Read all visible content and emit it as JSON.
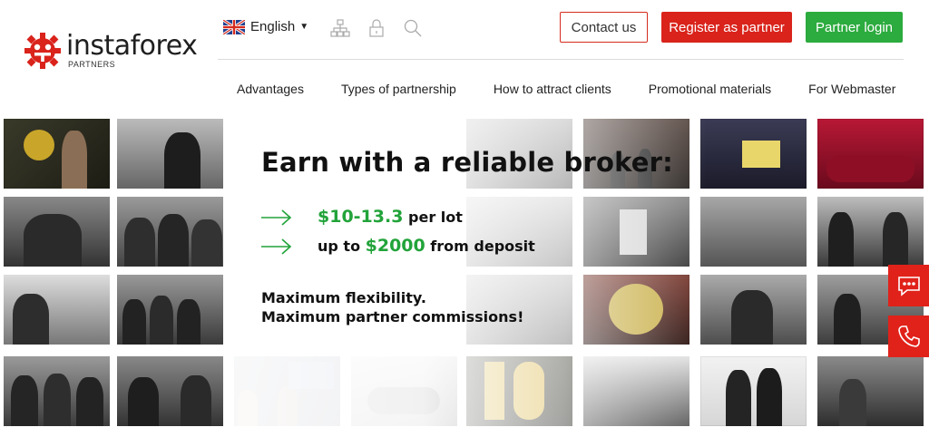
{
  "brand": {
    "name": "instaforex",
    "sub": "PARTNERS",
    "accent": "#d9231b",
    "green": "#2cab3e"
  },
  "header": {
    "language": "English",
    "contact_label": "Contact us",
    "register_label": "Register as partner",
    "login_label": "Partner login"
  },
  "nav": {
    "items": [
      "Advantages",
      "Types of partnership",
      "How to attract clients",
      "Promotional materials",
      "For Webmaster"
    ]
  },
  "promo": {
    "headline": "Earn with a reliable broker:",
    "offer1_value": "$10-13.3",
    "offer1_suffix": " per lot",
    "offer2_prefix": "up to ",
    "offer2_value": "$2000",
    "offer2_suffix": " from deposit",
    "line1": "Maximum flexibility.",
    "line2": "Maximum partner commissions!"
  },
  "side_actions": {
    "chat_icon": "chat-bubble-icon",
    "phone_icon": "phone-icon"
  }
}
